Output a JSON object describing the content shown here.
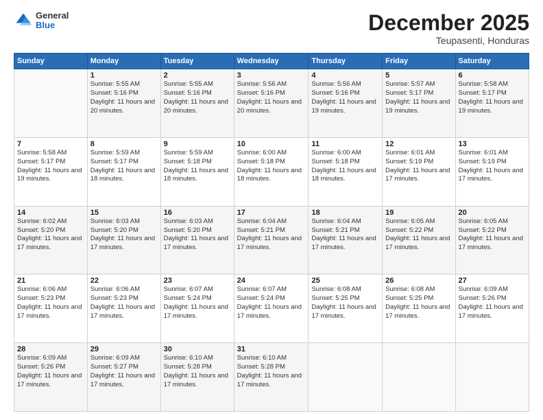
{
  "logo": {
    "general": "General",
    "blue": "Blue"
  },
  "title": {
    "month": "December 2025",
    "location": "Teupasenti, Honduras"
  },
  "days_header": [
    "Sunday",
    "Monday",
    "Tuesday",
    "Wednesday",
    "Thursday",
    "Friday",
    "Saturday"
  ],
  "weeks": [
    [
      {
        "day": "",
        "info": ""
      },
      {
        "day": "1",
        "info": "Sunrise: 5:55 AM\nSunset: 5:16 PM\nDaylight: 11 hours\nand 20 minutes."
      },
      {
        "day": "2",
        "info": "Sunrise: 5:55 AM\nSunset: 5:16 PM\nDaylight: 11 hours\nand 20 minutes."
      },
      {
        "day": "3",
        "info": "Sunrise: 5:56 AM\nSunset: 5:16 PM\nDaylight: 11 hours\nand 20 minutes."
      },
      {
        "day": "4",
        "info": "Sunrise: 5:56 AM\nSunset: 5:16 PM\nDaylight: 11 hours\nand 19 minutes."
      },
      {
        "day": "5",
        "info": "Sunrise: 5:57 AM\nSunset: 5:17 PM\nDaylight: 11 hours\nand 19 minutes."
      },
      {
        "day": "6",
        "info": "Sunrise: 5:58 AM\nSunset: 5:17 PM\nDaylight: 11 hours\nand 19 minutes."
      }
    ],
    [
      {
        "day": "7",
        "info": "Sunrise: 5:58 AM\nSunset: 5:17 PM\nDaylight: 11 hours\nand 19 minutes."
      },
      {
        "day": "8",
        "info": "Sunrise: 5:59 AM\nSunset: 5:17 PM\nDaylight: 11 hours\nand 18 minutes."
      },
      {
        "day": "9",
        "info": "Sunrise: 5:59 AM\nSunset: 5:18 PM\nDaylight: 11 hours\nand 18 minutes."
      },
      {
        "day": "10",
        "info": "Sunrise: 6:00 AM\nSunset: 5:18 PM\nDaylight: 11 hours\nand 18 minutes."
      },
      {
        "day": "11",
        "info": "Sunrise: 6:00 AM\nSunset: 5:18 PM\nDaylight: 11 hours\nand 18 minutes."
      },
      {
        "day": "12",
        "info": "Sunrise: 6:01 AM\nSunset: 5:19 PM\nDaylight: 11 hours\nand 17 minutes."
      },
      {
        "day": "13",
        "info": "Sunrise: 6:01 AM\nSunset: 5:19 PM\nDaylight: 11 hours\nand 17 minutes."
      }
    ],
    [
      {
        "day": "14",
        "info": "Sunrise: 6:02 AM\nSunset: 5:20 PM\nDaylight: 11 hours\nand 17 minutes."
      },
      {
        "day": "15",
        "info": "Sunrise: 6:03 AM\nSunset: 5:20 PM\nDaylight: 11 hours\nand 17 minutes."
      },
      {
        "day": "16",
        "info": "Sunrise: 6:03 AM\nSunset: 5:20 PM\nDaylight: 11 hours\nand 17 minutes."
      },
      {
        "day": "17",
        "info": "Sunrise: 6:04 AM\nSunset: 5:21 PM\nDaylight: 11 hours\nand 17 minutes."
      },
      {
        "day": "18",
        "info": "Sunrise: 6:04 AM\nSunset: 5:21 PM\nDaylight: 11 hours\nand 17 minutes."
      },
      {
        "day": "19",
        "info": "Sunrise: 6:05 AM\nSunset: 5:22 PM\nDaylight: 11 hours\nand 17 minutes."
      },
      {
        "day": "20",
        "info": "Sunrise: 6:05 AM\nSunset: 5:22 PM\nDaylight: 11 hours\nand 17 minutes."
      }
    ],
    [
      {
        "day": "21",
        "info": "Sunrise: 6:06 AM\nSunset: 5:23 PM\nDaylight: 11 hours\nand 17 minutes."
      },
      {
        "day": "22",
        "info": "Sunrise: 6:06 AM\nSunset: 5:23 PM\nDaylight: 11 hours\nand 17 minutes."
      },
      {
        "day": "23",
        "info": "Sunrise: 6:07 AM\nSunset: 5:24 PM\nDaylight: 11 hours\nand 17 minutes."
      },
      {
        "day": "24",
        "info": "Sunrise: 6:07 AM\nSunset: 5:24 PM\nDaylight: 11 hours\nand 17 minutes."
      },
      {
        "day": "25",
        "info": "Sunrise: 6:08 AM\nSunset: 5:25 PM\nDaylight: 11 hours\nand 17 minutes."
      },
      {
        "day": "26",
        "info": "Sunrise: 6:08 AM\nSunset: 5:25 PM\nDaylight: 11 hours\nand 17 minutes."
      },
      {
        "day": "27",
        "info": "Sunrise: 6:09 AM\nSunset: 5:26 PM\nDaylight: 11 hours\nand 17 minutes."
      }
    ],
    [
      {
        "day": "28",
        "info": "Sunrise: 6:09 AM\nSunset: 5:26 PM\nDaylight: 11 hours\nand 17 minutes."
      },
      {
        "day": "29",
        "info": "Sunrise: 6:09 AM\nSunset: 5:27 PM\nDaylight: 11 hours\nand 17 minutes."
      },
      {
        "day": "30",
        "info": "Sunrise: 6:10 AM\nSunset: 5:28 PM\nDaylight: 11 hours\nand 17 minutes."
      },
      {
        "day": "31",
        "info": "Sunrise: 6:10 AM\nSunset: 5:28 PM\nDaylight: 11 hours\nand 17 minutes."
      },
      {
        "day": "",
        "info": ""
      },
      {
        "day": "",
        "info": ""
      },
      {
        "day": "",
        "info": ""
      }
    ]
  ]
}
